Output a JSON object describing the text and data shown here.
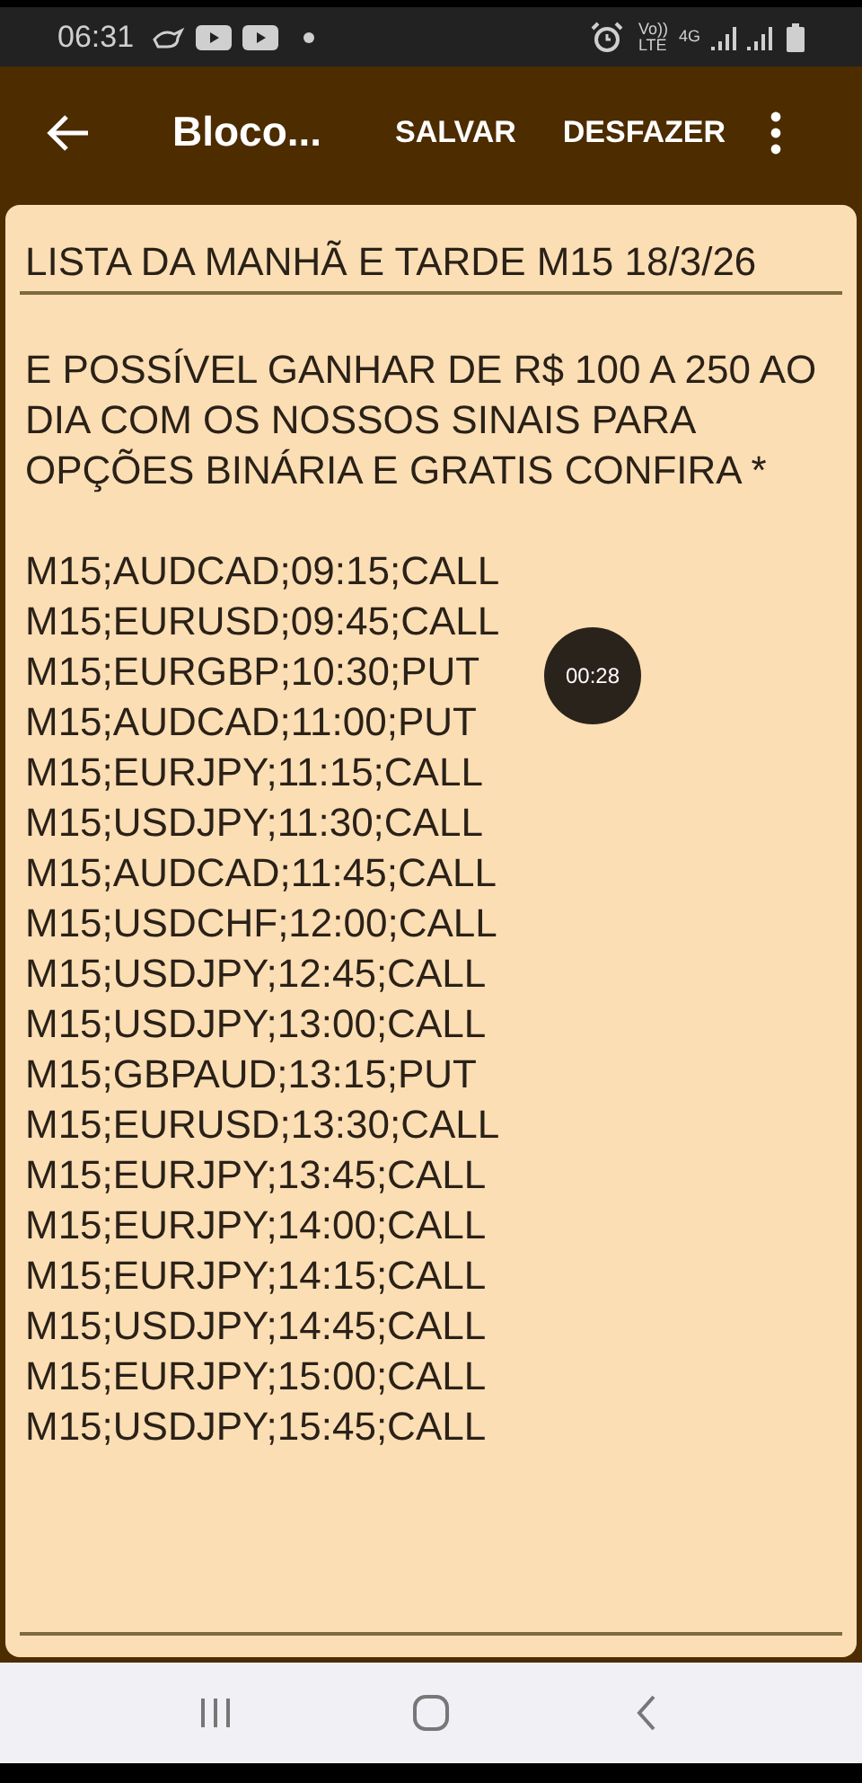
{
  "status_bar": {
    "time": "06:31",
    "volte_top": "Vo))",
    "volte_bottom": "LTE",
    "network": "4G"
  },
  "app_bar": {
    "title": "Bloco...",
    "actions": [
      "SALVAR",
      "DESFAZER"
    ]
  },
  "note": {
    "title": "LISTA DA MANHÃ E TARDE M15 18/3/26",
    "body": [
      "E POSSÍVEL GANHAR DE R$ 100 A 250 AO DIA COM OS NOSSOS SINAIS PARA OPÇÕES BINÁRIA E GRATIS CONFIRA *",
      "M15;AUDCAD;09:15;CALL",
      "M15;EURUSD;09:45;CALL",
      "M15;EURGBP;10:30;PUT",
      "M15;AUDCAD;11:00;PUT",
      "M15;EURJPY;11:15;CALL",
      "M15;USDJPY;11:30;CALL",
      "M15;AUDCAD;11:45;CALL",
      "M15;USDCHF;12:00;CALL",
      "M15;USDJPY;12:45;CALL",
      "M15;USDJPY;13:00;CALL",
      "M15;GBPAUD;13:15;PUT",
      "M15;EURUSD;13:30;CALL",
      "M15;EURJPY;13:45;CALL",
      "M15;EURJPY;14:00;CALL",
      "M15;EURJPY;14:15;CALL",
      "M15;USDJPY;14:45;CALL",
      "M15;EURJPY;15:00;CALL",
      "M15;USDJPY;15:45;CALL"
    ]
  },
  "recording_timer": "00:28"
}
